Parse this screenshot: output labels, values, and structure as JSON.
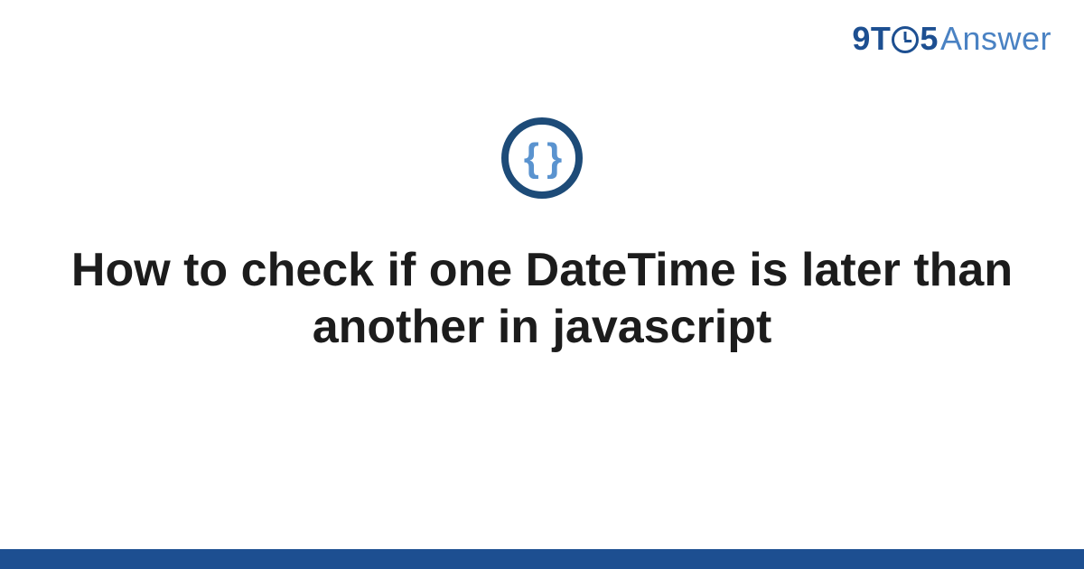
{
  "brand": {
    "part1": "9T",
    "part2": "5",
    "part3": "Answer"
  },
  "icon": {
    "glyph": "{ }"
  },
  "headline": "How to check if one DateTime is later than another in javascript",
  "colors": {
    "brand_dark": "#1d4f91",
    "brand_light": "#4a82c3",
    "ring": "#1d4b78",
    "braces": "#5a93cf",
    "footer": "#1d4f91",
    "text": "#1c1c1c"
  }
}
